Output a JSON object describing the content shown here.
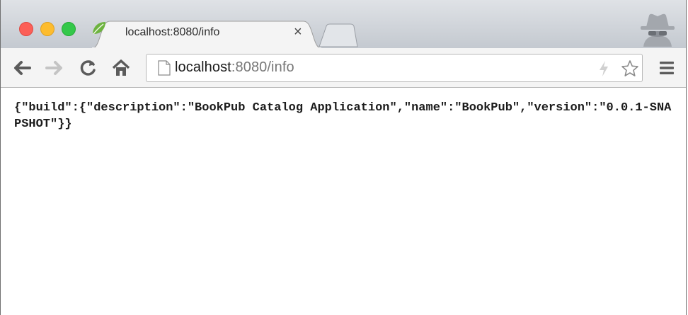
{
  "browser": {
    "tab": {
      "title": "localhost:8080/info",
      "favicon": "spring-leaf-icon",
      "close_glyph": "×"
    },
    "omnibox": {
      "host": "localhost",
      "rest": ":8080/info"
    },
    "icons": [
      "back-arrow-icon",
      "forward-arrow-icon",
      "reload-icon",
      "home-icon",
      "page-icon",
      "bolt-icon",
      "star-icon",
      "hamburger-menu-icon",
      "incognito-icon"
    ]
  },
  "page": {
    "json_text": "{\"build\":{\"description\":\"BookPub Catalog Application\",\"name\":\"BookPub\",\"version\":\"0.0.1-SNAPSHOT\"}}"
  },
  "colors": {
    "close_red": "#fc5f57",
    "minimize_yellow": "#fdbc2e",
    "zoom_green": "#34c84a",
    "spring_green": "#6db33f"
  }
}
